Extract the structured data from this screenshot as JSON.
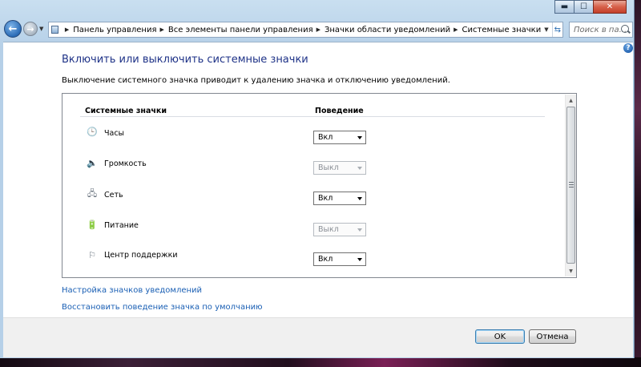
{
  "window": {
    "caption_buttons": {
      "minimize": "▬",
      "maximize": "☐",
      "close": "✕"
    }
  },
  "nav": {
    "back_label": "←",
    "forward_label": "→",
    "breadcrumbs": [
      "Панель управления",
      "Все элементы панели управления",
      "Значки области уведомлений",
      "Системные значки"
    ],
    "search_placeholder": "Поиск в па..."
  },
  "page": {
    "help_label": "?",
    "title": "Включить или выключить системные значки",
    "description": "Выключение системного значка приводит к удалению значка и отключению уведомлений."
  },
  "table": {
    "header_icons": "Системные значки",
    "header_behavior": "Поведение",
    "rows": [
      {
        "icon": "clock-icon",
        "label": "Часы",
        "value": "Вкл",
        "enabled": true
      },
      {
        "icon": "volume-icon",
        "label": "Громкость",
        "value": "Выкл",
        "enabled": false
      },
      {
        "icon": "network-icon",
        "label": "Сеть",
        "value": "Вкл",
        "enabled": true
      },
      {
        "icon": "power-icon",
        "label": "Питание",
        "value": "Выкл",
        "enabled": false
      },
      {
        "icon": "action-center-flag-icon",
        "label": "Центр поддержки",
        "value": "Вкл",
        "enabled": true
      }
    ]
  },
  "links": {
    "customize": "Настройка значков уведомлений",
    "restore": "Восстановить поведение значка по умолчанию"
  },
  "buttons": {
    "ok": "OK",
    "cancel": "Отмена"
  },
  "colors": {
    "title": "#1e3287",
    "link": "#1a5fb4",
    "frame": "#b6d0e8"
  }
}
